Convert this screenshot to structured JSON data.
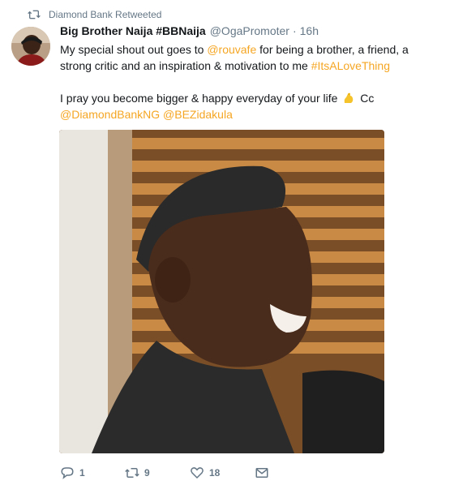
{
  "retweet_banner": {
    "text": "Diamond Bank Retweeted"
  },
  "tweet": {
    "display_name": "Big Brother Naija #BBNaija",
    "handle": "@OgaPromoter",
    "separator": "·",
    "time": "16h",
    "line1_a": "My special shout out goes to ",
    "mention1": "@rouvafe",
    "line1_b": " for being a brother, a friend, a strong critic and an inspiration & motivation to me ",
    "hashtag": "#ItsALoveThing",
    "line2_a": "I pray you become bigger & happy everyday of your life ",
    "line2_b": " Cc",
    "mention2": "@DiamondBankNG",
    "mention3": "@BEZidakula"
  },
  "actions": {
    "replies": "1",
    "retweets": "9",
    "likes": "18"
  },
  "colors": {
    "link": "#f5a623",
    "muted": "#657786",
    "text": "#14171a"
  },
  "icons": [
    "retweet-icon",
    "reply-icon",
    "like-icon",
    "dm-icon",
    "flexed-biceps-emoji"
  ]
}
